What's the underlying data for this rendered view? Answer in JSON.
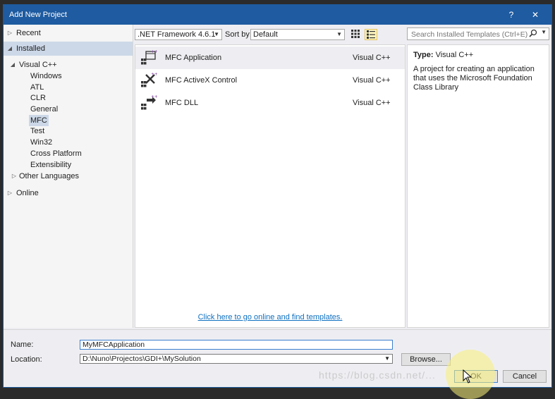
{
  "window": {
    "title": "Add New Project",
    "help_label": "?",
    "close_label": "✕"
  },
  "tree": {
    "recent": "Recent",
    "installed": "Installed",
    "visual_cpp": "Visual C++",
    "children": [
      "Windows",
      "ATL",
      "CLR",
      "General",
      "MFC",
      "Test",
      "Win32",
      "Cross Platform",
      "Extensibility"
    ],
    "other_languages": "Other Languages",
    "online": "Online",
    "selected": "MFC"
  },
  "toolbar": {
    "framework": ".NET Framework 4.6.1",
    "sort_label": "Sort by:",
    "sort_value": "Default"
  },
  "search": {
    "placeholder": "Search Installed Templates (Ctrl+E)"
  },
  "templates": [
    {
      "name": "MFC Application",
      "lang": "Visual C++",
      "icon": "mfc-application-icon"
    },
    {
      "name": "MFC ActiveX Control",
      "lang": "Visual C++",
      "icon": "mfc-activex-icon"
    },
    {
      "name": "MFC DLL",
      "lang": "Visual C++",
      "icon": "mfc-dll-icon"
    }
  ],
  "online_link": "Click here to go online and find templates.",
  "details": {
    "type_label": "Type:",
    "type_value": "Visual C++",
    "description": "A project for creating an application that uses the Microsoft Foundation Class Library"
  },
  "form": {
    "name_label": "Name:",
    "name_value": "MyMFCApplication",
    "location_label": "Location:",
    "location_value": "D:\\Nuno\\Projectos\\GDI+\\MySolution",
    "browse_label": "Browse...",
    "ok_label": "OK",
    "cancel_label": "Cancel"
  },
  "watermark": "https://blog.csdn.net/..."
}
